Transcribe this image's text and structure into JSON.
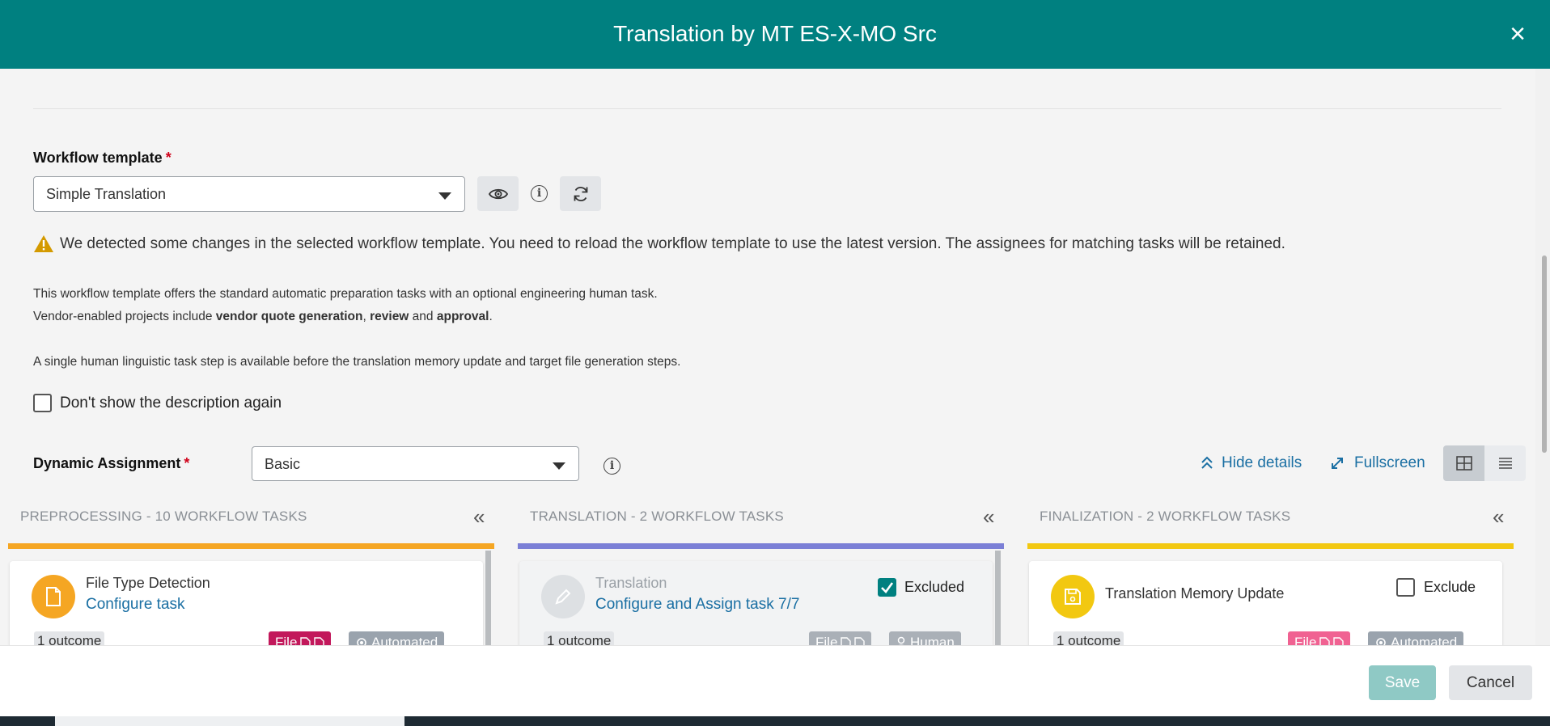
{
  "header": {
    "title": "Translation by MT ES-X-MO Src",
    "close_icon": "×"
  },
  "workflow_template": {
    "label": "Workflow template",
    "required_mark": "*",
    "selected": "Simple Translation",
    "info_glyph": "i"
  },
  "warning": {
    "text": "We detected some changes in the selected workflow template. You need to reload the workflow template to use the latest version. The assignees for matching tasks will be retained."
  },
  "description": {
    "line1": "This workflow template offers the standard automatic preparation tasks with an optional engineering human task.",
    "line2_prefix": "Vendor-enabled projects include ",
    "line2_b1": "vendor quote generation",
    "line2_sep": ", ",
    "line2_b2": "review",
    "line2_and": " and ",
    "line2_b3": "approval",
    "line2_end": ".",
    "line3": "A single human linguistic task step is available before the translation memory update and target file generation steps."
  },
  "dont_show": {
    "label": "Don't show the description again",
    "checked": false
  },
  "dynamic_assignment": {
    "label": "Dynamic Assignment",
    "required_mark": "*",
    "selected": "Basic",
    "info_glyph": "i"
  },
  "view_controls": {
    "hide_details": "Hide details",
    "fullscreen": "Fullscreen"
  },
  "columns": [
    {
      "title": "PREPROCESSING - 10 WORKFLOW TASKS",
      "color": "#f5a623",
      "collapse": "«"
    },
    {
      "title": "TRANSLATION - 2 WORKFLOW TASKS",
      "color": "#7b7fd6",
      "collapse": "«"
    },
    {
      "title": "FINALIZATION - 2 WORKFLOW TASKS",
      "color": "#f2c811",
      "collapse": "«"
    }
  ],
  "cards": [
    {
      "name": "File Type Detection",
      "configure": "Configure task",
      "outcome": "1 outcome",
      "tag1": "File",
      "tag2": "Automated",
      "tag1_color": "#c2185b",
      "tag2_color": "#9aa3ad",
      "avatar_color": "#f5a623"
    },
    {
      "name": "Translation",
      "configure": "Configure and Assign task 7/7",
      "outcome": "1 outcome",
      "tag1": "File",
      "tag2": "Human",
      "tag1_color": "#aab0b7",
      "tag2_color": "#aab0b7",
      "avatar_color": "#dde0e3",
      "exclude_label": "Excluded",
      "excluded": true
    },
    {
      "name": "Translation Memory Update",
      "outcome": "1 outcome",
      "tag1": "File",
      "tag2": "Automated",
      "tag1_color": "#f06292",
      "tag2_color": "#9aa3ad",
      "avatar_color": "#f2c811",
      "exclude_label": "Exclude",
      "excluded": false
    }
  ],
  "footer": {
    "save": "Save",
    "cancel": "Cancel"
  }
}
